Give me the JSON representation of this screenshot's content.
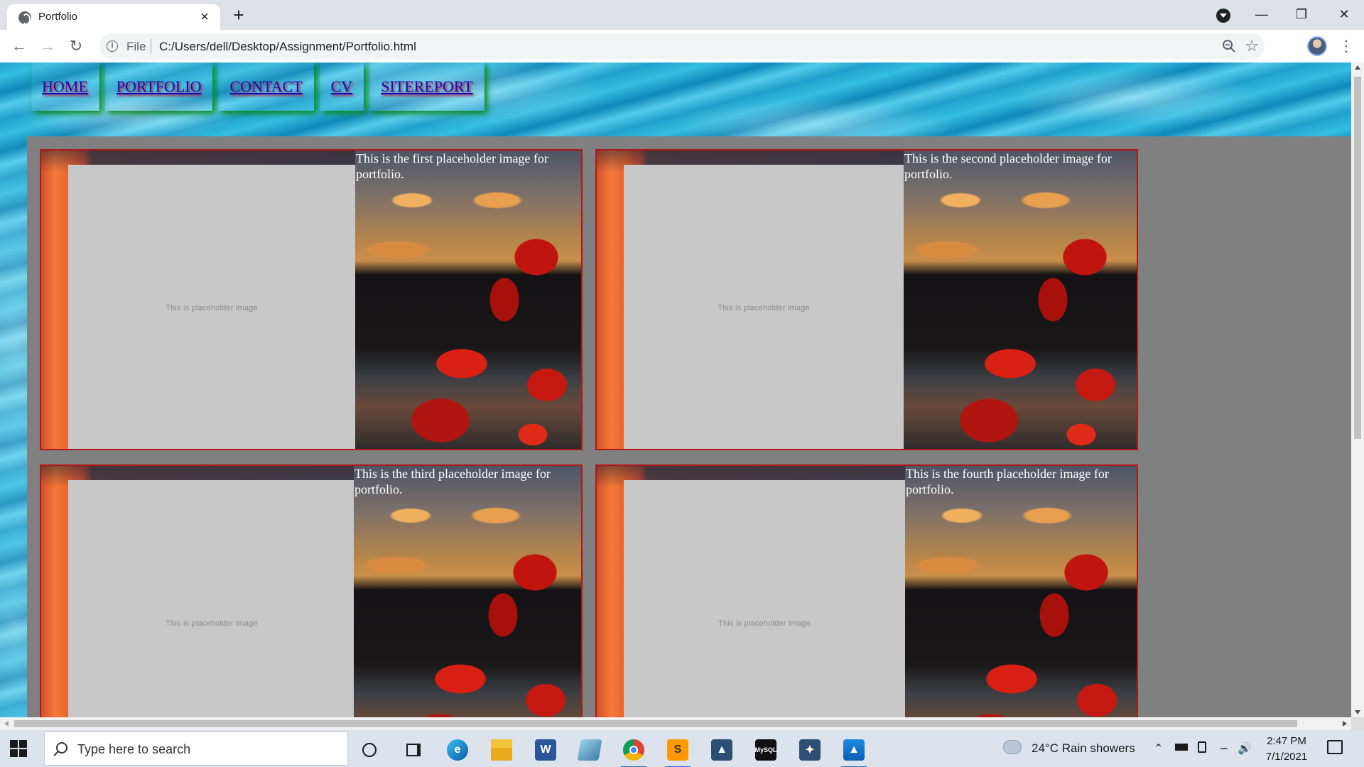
{
  "browser": {
    "tab_title": "Portfolio",
    "url_scheme": "File",
    "url": "C:/Users/dell/Desktop/Assignment/Portfolio.html"
  },
  "nav": {
    "items": [
      {
        "label": "HOME"
      },
      {
        "label": "PORTFOLIO"
      },
      {
        "label": "CONTACT"
      },
      {
        "label": "CV"
      },
      {
        "label": "SITEREPORT"
      }
    ]
  },
  "portfolio": {
    "cards": [
      {
        "placeholder": "This is placeholder image",
        "caption": "This is the first placeholder image for portfolio."
      },
      {
        "placeholder": "This is placeholder image",
        "caption": "This is the second placeholder image for portfolio."
      },
      {
        "placeholder": "This is placeholder image",
        "caption": "This is the third placeholder image for portfolio."
      },
      {
        "placeholder": "This is placeholder image",
        "caption": "This is the fourth placeholder image for portfolio."
      }
    ]
  },
  "taskbar": {
    "search_placeholder": "Type here to search",
    "weather": "24°C  Rain showers",
    "time": "2:47 PM",
    "date": "7/1/2021"
  },
  "colors": {
    "nav_link": "#1a0dab",
    "nav_shadow": "#0a8a12",
    "content_bg": "#808080",
    "card_border": "#b01818"
  }
}
